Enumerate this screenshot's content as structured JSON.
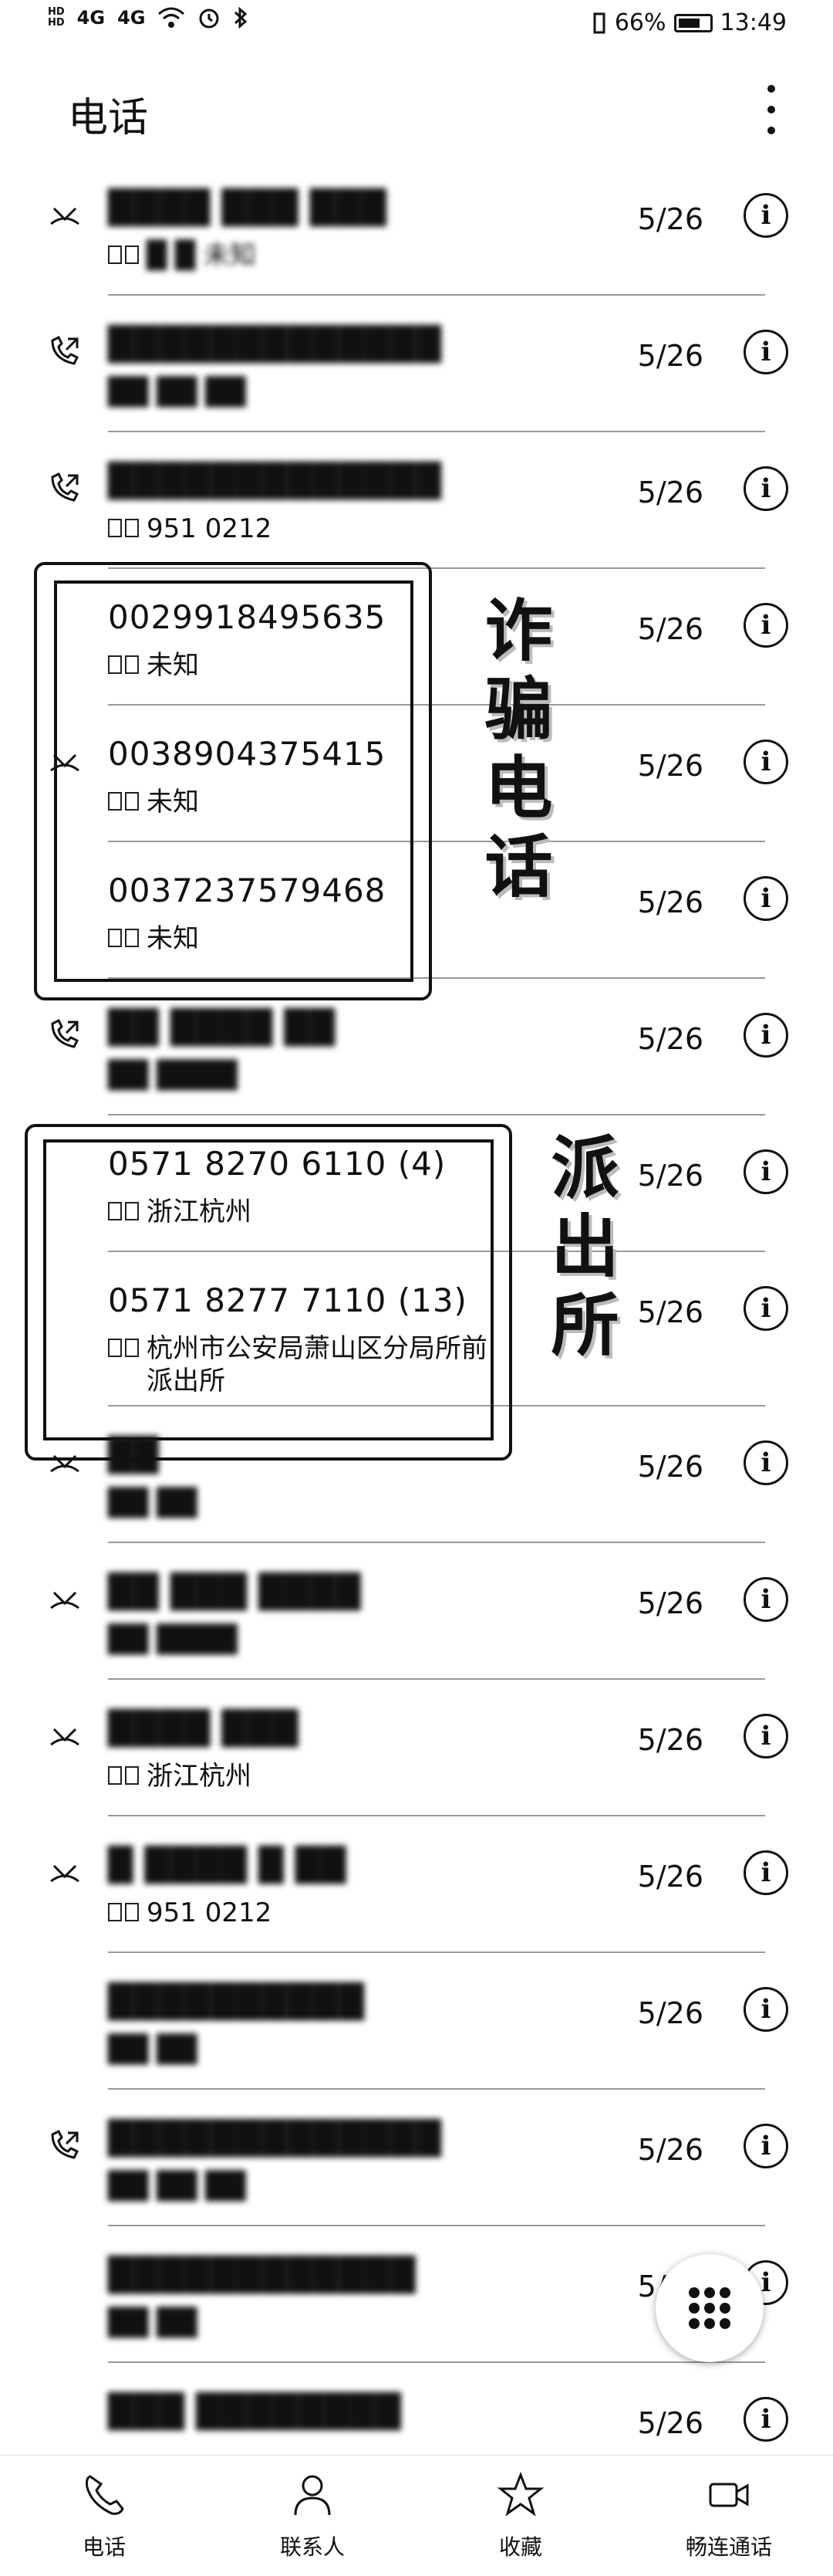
{
  "status_bar": {
    "network": "4G",
    "network2": "4G",
    "battery": "66%",
    "time": "13:49"
  },
  "header": {
    "title": "电话"
  },
  "calls": [
    {
      "caller": "████ ███ ███",
      "location": "█ █ 未知",
      "date": "5/26",
      "type": "missed",
      "blurred": true
    },
    {
      "caller": "█████████████",
      "location": "██ ██ ██",
      "date": "5/26",
      "type": "outgoing",
      "blurred": true
    },
    {
      "caller": "█████████████",
      "location": "951 0212",
      "date": "5/26",
      "type": "outgoing",
      "blurred": true
    },
    {
      "caller": "0029918495635",
      "location": "未知",
      "date": "5/26",
      "type": "none",
      "blurred": false
    },
    {
      "caller": "0038904375415",
      "location": "未知",
      "date": "5/26",
      "type": "missed",
      "blurred": false
    },
    {
      "caller": "0037237579468",
      "location": "未知",
      "date": "5/26",
      "type": "none",
      "blurred": false
    },
    {
      "caller": "██ ████ ██",
      "location": "██ ████",
      "date": "5/26",
      "type": "outgoing",
      "blurred": true
    },
    {
      "caller": "0571 8270 6110 (4)",
      "location": "浙江杭州",
      "date": "5/26",
      "type": "none",
      "blurred": false
    },
    {
      "caller": "0571 8277 7110 (13)",
      "location": "杭州市公安局萧山区分局所前派出所",
      "date": "5/26",
      "type": "none",
      "blurred": false
    },
    {
      "caller": "██",
      "location": "██ ██",
      "date": "5/26",
      "type": "missed",
      "blurred": true
    },
    {
      "caller": "██ ███ ████",
      "location": "██ ████",
      "date": "5/26",
      "type": "missed",
      "blurred": true
    },
    {
      "caller": "████ ███",
      "location": "浙江杭州",
      "date": "5/26",
      "type": "missed",
      "blurred": true
    },
    {
      "caller": "█ ████ █ ██",
      "location": "951 0212",
      "date": "5/26",
      "type": "missed",
      "blurred": true
    },
    {
      "caller": "██████████",
      "location": "██ ██",
      "date": "5/26",
      "type": "none",
      "blurred": true
    },
    {
      "caller": "█████████████",
      "location": "██ ██ ██",
      "date": "5/26",
      "type": "outgoing",
      "blurred": true
    },
    {
      "caller": "████████████",
      "location": "██ ██",
      "date": "5/26",
      "type": "none",
      "blurred": true
    },
    {
      "caller": "███ ████████",
      "location": "",
      "date": "5/26",
      "type": "none",
      "blurred": true
    }
  ],
  "annotations": {
    "fraud_label": "诈骗电话",
    "police_label": "派出所"
  },
  "bottom_nav": {
    "items": [
      {
        "label": "电话",
        "icon": "phone-icon"
      },
      {
        "label": "联系人",
        "icon": "contacts-icon"
      },
      {
        "label": "收藏",
        "icon": "star-icon"
      },
      {
        "label": "畅连通话",
        "icon": "video-call-icon"
      }
    ]
  }
}
